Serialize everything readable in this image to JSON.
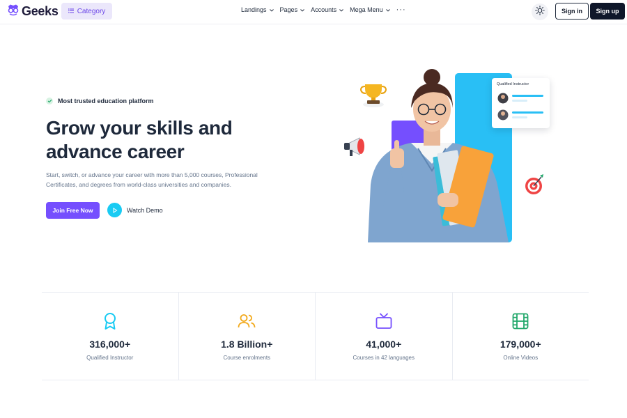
{
  "brand": {
    "name": "Geeks",
    "icon": "geeks-logo-icon"
  },
  "header": {
    "category_label": "Category",
    "nav": [
      {
        "label": "Landings"
      },
      {
        "label": "Pages"
      },
      {
        "label": "Accounts"
      },
      {
        "label": "Mega Menu"
      }
    ],
    "more_label": "···",
    "signin_label": "Sign in",
    "signup_label": "Sign up"
  },
  "hero": {
    "badge_text": "Most trusted education platform",
    "title_line1": "Grow your skills and",
    "title_line2": "advance career",
    "subtitle": "Start, switch, or advance your career with more than 5,000 courses, Professional Certificates, and degrees from world-class universities and companies.",
    "primary_button": "Join Free Now",
    "secondary_button": "Watch Demo",
    "card_title": "Qualified Instructor"
  },
  "stats": [
    {
      "value": "316,000+",
      "label": "Qualified Instructor",
      "icon": "award-icon",
      "color": "#19cbf3"
    },
    {
      "value": "1.8 Billion+",
      "label": "Course enrolments",
      "icon": "users-icon",
      "color": "#f2a91b"
    },
    {
      "value": "41,000+",
      "label": "Courses in 42 languages",
      "icon": "tv-icon",
      "color": "#754ffe"
    },
    {
      "value": "179,000+",
      "label": "Online Videos",
      "icon": "film-icon",
      "color": "#22a86b"
    }
  ],
  "colors": {
    "primary": "#754ffe",
    "accent_cyan": "#19cbf3",
    "dark": "#0f172a"
  }
}
